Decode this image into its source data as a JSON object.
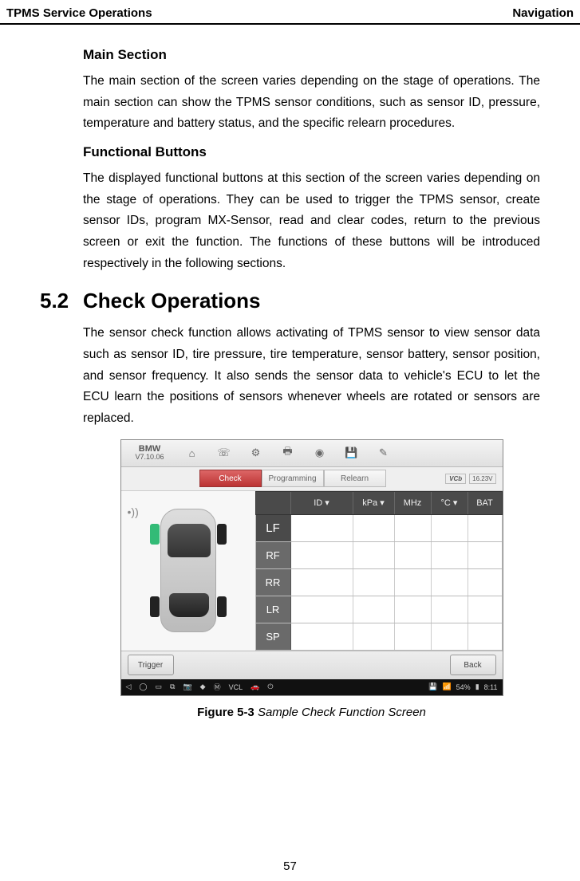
{
  "header": {
    "left": "TPMS Service Operations",
    "right": "Navigation"
  },
  "headings": {
    "main_section": "Main Section",
    "functional_buttons": "Functional Buttons"
  },
  "paragraphs": {
    "main_section": "The main section of the screen varies depending on the stage of operations. The main section can show the TPMS sensor conditions, such as sensor ID, pressure, temperature and battery status, and the specific relearn procedures.",
    "functional_buttons": "The displayed functional buttons at this section of the screen varies depending on the stage of operations. They can be used to trigger the TPMS sensor, create sensor IDs, program MX-Sensor, read and clear codes, return to the previous screen or exit the function. The functions of these buttons will be introduced respectively in the following sections.",
    "check_ops": "The sensor check function allows activating of TPMS sensor to view sensor data such as sensor ID, tire pressure, tire temperature, sensor battery, sensor position, and sensor frequency. It also sends the sensor data to vehicle's ECU to let the ECU learn the positions of sensors whenever wheels are rotated or sensors are replaced."
  },
  "section": {
    "number": "5.2",
    "title": "Check Operations"
  },
  "figure": {
    "label": "Figure 5-3",
    "caption": "Sample Check Function Screen"
  },
  "page_number": "57",
  "mock": {
    "brand_name": "BMW",
    "brand_ver": "V7.10.06",
    "tabs": {
      "check": "Check",
      "programming": "Programming",
      "relearn": "Relearn"
    },
    "vci": "VCb",
    "voltage": "16.23V",
    "columns": {
      "id": "ID ▾",
      "kpa": "kPa ▾",
      "mhz": "MHz",
      "c": "°C ▾",
      "bat": "BAT"
    },
    "rows": [
      "LF",
      "RF",
      "RR",
      "LR",
      "SP"
    ],
    "trigger": "Trigger",
    "back": "Back",
    "statusbar": {
      "car_icon": "🚗",
      "vcl": "VCL",
      "m_icon": "Ⓜ",
      "signal": "📶",
      "battery": "54%",
      "time": "8:11"
    }
  }
}
